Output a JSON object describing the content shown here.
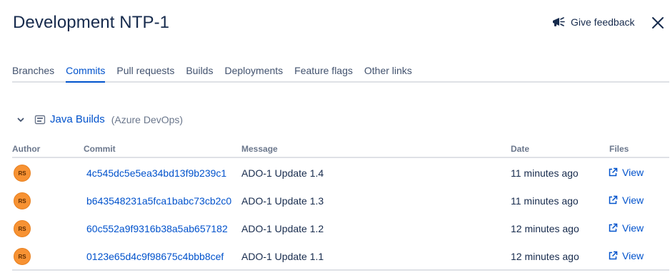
{
  "header": {
    "title": "Development NTP-1",
    "feedback_label": "Give feedback"
  },
  "tabs": [
    {
      "label": "Branches"
    },
    {
      "label": "Commits"
    },
    {
      "label": "Pull requests"
    },
    {
      "label": "Builds"
    },
    {
      "label": "Deployments"
    },
    {
      "label": "Feature flags"
    },
    {
      "label": "Other links"
    }
  ],
  "active_tab": "Commits",
  "section": {
    "title": "Java Builds",
    "subtitle": "(Azure DevOps)"
  },
  "table": {
    "columns": {
      "author": "Author",
      "commit": "Commit",
      "message": "Message",
      "date": "Date",
      "files": "Files"
    },
    "rows": [
      {
        "author": "RS",
        "commit": "4c545dc5e5ea34bd13f9b239c1",
        "message": "ADO-1 Update 1.4",
        "date": "11 minutes ago",
        "files": "View"
      },
      {
        "author": "RS",
        "commit": "b643548231a5fca1babc73cb2c0",
        "message": "ADO-1 Update 1.3",
        "date": "11 minutes ago",
        "files": "View"
      },
      {
        "author": "RS",
        "commit": "60c552a9f9316b38a5ab657182",
        "message": "ADO-1 Update 1.2",
        "date": "12 minutes ago",
        "files": "View"
      },
      {
        "author": "RS",
        "commit": "0123e65d4c9f98675c4bbb8cef",
        "message": "ADO-1 Update 1.1",
        "date": "12 minutes ago",
        "files": "View"
      }
    ]
  },
  "colors": {
    "link": "#0052cc",
    "text": "#172b4d",
    "muted": "#6b778c",
    "avatar": "#f79233",
    "divider": "#dfe1e6"
  },
  "icons": {
    "feedback": "megaphone-icon",
    "close": "close-icon",
    "collapse": "chevron-down-icon",
    "build": "build-pipeline-icon",
    "files": "external-link-icon"
  }
}
